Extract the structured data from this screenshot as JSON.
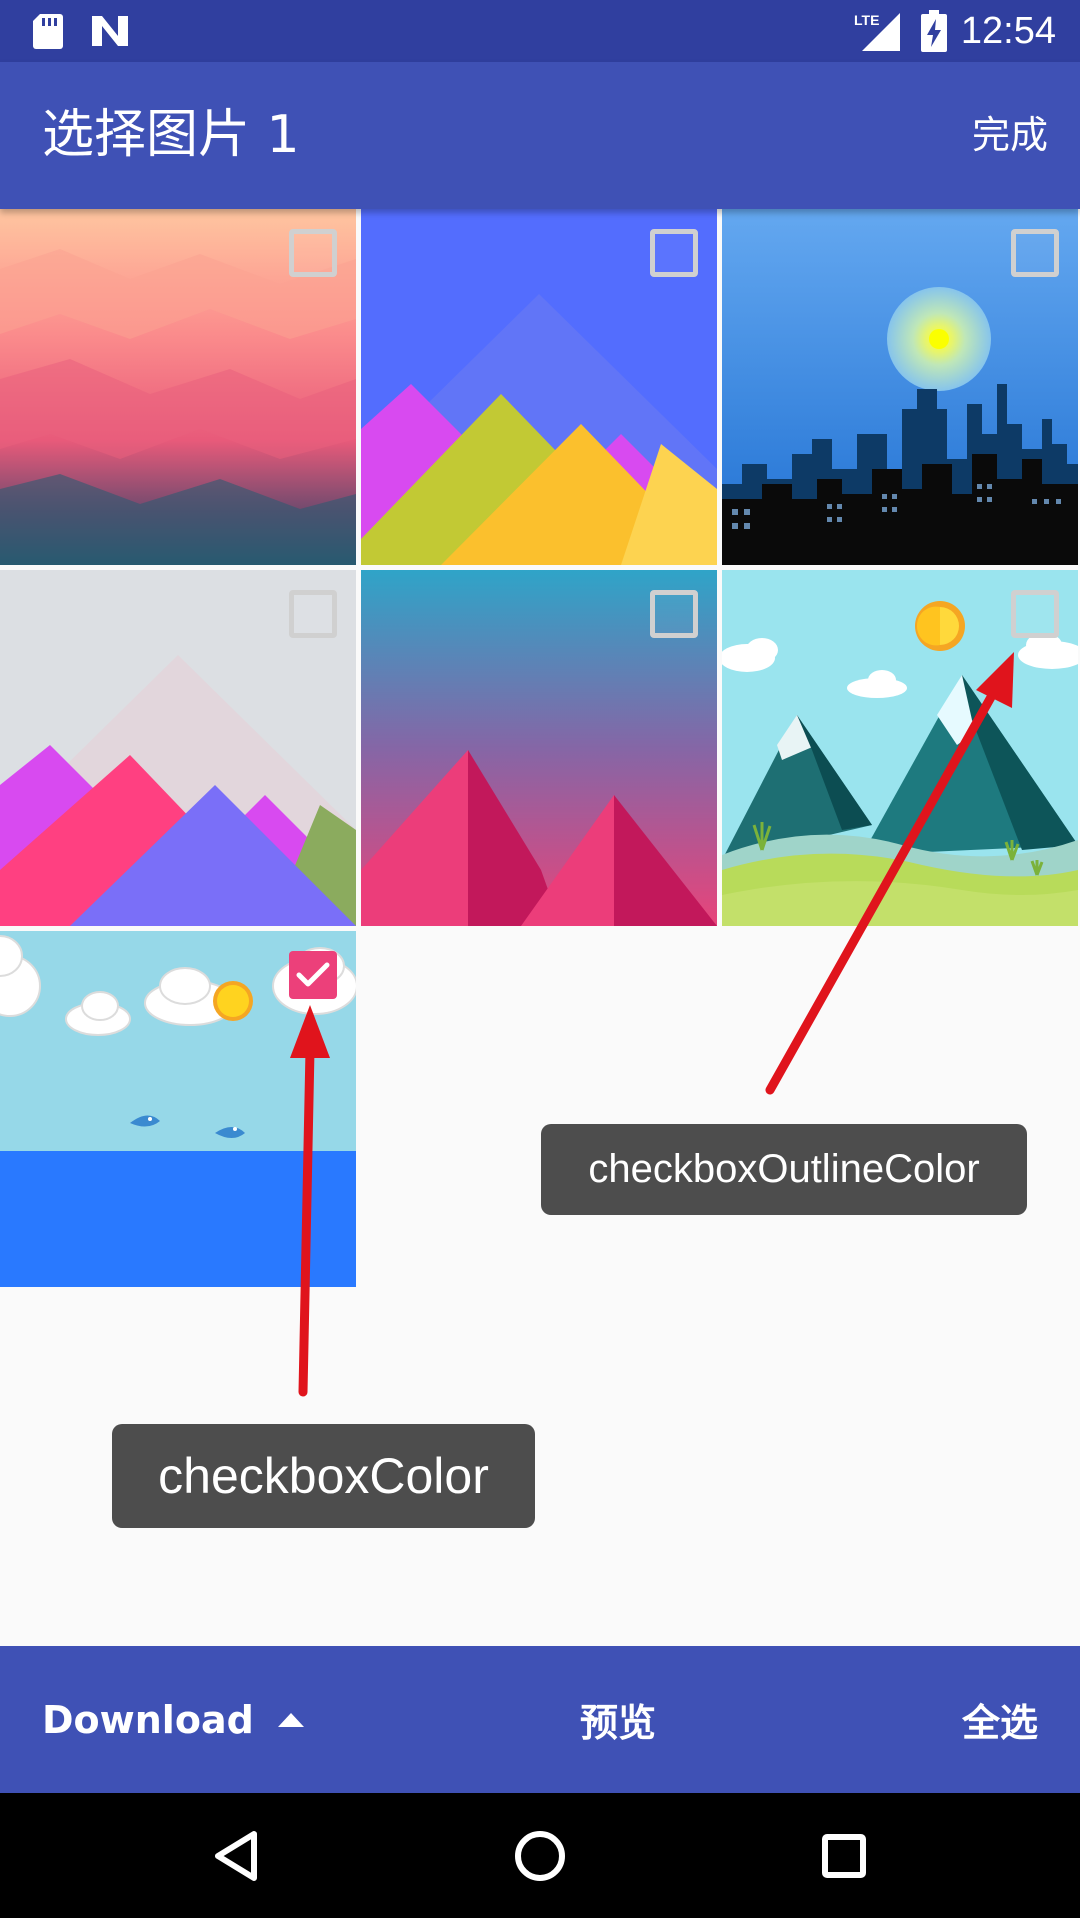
{
  "status_bar": {
    "time": "12:54",
    "network": "LTE",
    "icons": [
      "sd-card-icon",
      "n-logo-icon",
      "lte-signal-icon",
      "battery-charging-icon"
    ]
  },
  "app_bar": {
    "title": "选择图片 1",
    "done_label": "完成"
  },
  "photos": [
    {
      "name": "pink-polygon-wallpaper",
      "checked": false
    },
    {
      "name": "blue-mountains-wallpaper",
      "checked": false
    },
    {
      "name": "city-skyline-wallpaper",
      "checked": false
    },
    {
      "name": "grey-mountains-wallpaper",
      "checked": false
    },
    {
      "name": "pink-pyramids-wallpaper",
      "checked": false
    },
    {
      "name": "snowy-mountains-wallpaper",
      "checked": false
    },
    {
      "name": "sky-sea-wallpaper",
      "checked": true
    }
  ],
  "annotations": {
    "outline_label": "checkboxOutlineColor",
    "checked_label": "checkboxColor",
    "arrow_color": "#e0141c"
  },
  "bottom_bar": {
    "folder_label": "Download",
    "preview_label": "预览",
    "select_all_label": "全选"
  },
  "colors": {
    "primary": "#3f51b5",
    "primary_dark": "#303f9f",
    "accent_checkbox": "#ec407a",
    "checkbox_outline": "#d0d0d0"
  }
}
